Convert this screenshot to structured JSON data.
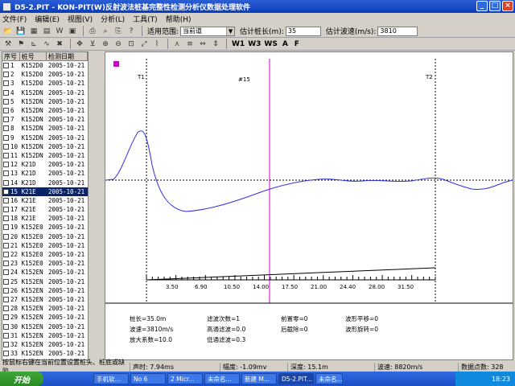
{
  "window": {
    "title": "D5-2.PIT - KON-PIT(W)反射波法桩基完整性检测分析仪数据处理软件"
  },
  "menu": [
    "文件(F)",
    "编辑(E)",
    "视图(V)",
    "分析(L)",
    "工具(T)",
    "帮助(H)"
  ],
  "toolbar": {
    "range_label": "适用范围:",
    "range_value": "当前道",
    "pile_len_label": "估计桩长(m):",
    "pile_len_value": "35",
    "wave_speed_label": "估计波速(m/s):",
    "wave_speed_value": "3810",
    "w1": "W1",
    "w3": "W3",
    "ws": "WS",
    "a": "A",
    "f": "F"
  },
  "list": {
    "headers": [
      "序号",
      "桩号",
      "检测日期"
    ],
    "rows": [
      [
        "1",
        "K152D0",
        "2005-10-21"
      ],
      [
        "2",
        "K152D0",
        "2005-10-21"
      ],
      [
        "3",
        "K152D0",
        "2005-10-21"
      ],
      [
        "4",
        "K152DN",
        "2005-10-21"
      ],
      [
        "5",
        "K152DN",
        "2005-10-21"
      ],
      [
        "6",
        "K152DN",
        "2005-10-21"
      ],
      [
        "7",
        "K152DN",
        "2005-10-21"
      ],
      [
        "8",
        "K152DN",
        "2005-10-21"
      ],
      [
        "9",
        "K152DN",
        "2005-10-21"
      ],
      [
        "10",
        "K152DN",
        "2005-10-21"
      ],
      [
        "11",
        "K152DN",
        "2005-10-21"
      ],
      [
        "12",
        "K21D",
        "2005-10-21"
      ],
      [
        "13",
        "K21D",
        "2005-10-21"
      ],
      [
        "14",
        "K21D",
        "2005-10-21"
      ],
      [
        "15",
        "K21E",
        "2005-10-21"
      ],
      [
        "16",
        "K21E",
        "2005-10-21"
      ],
      [
        "17",
        "K21E",
        "2005-10-21"
      ],
      [
        "18",
        "K21E",
        "2005-10-21"
      ],
      [
        "19",
        "K152E0",
        "2005-10-21"
      ],
      [
        "20",
        "K152E0",
        "2005-10-21"
      ],
      [
        "21",
        "K152E0",
        "2005-10-21"
      ],
      [
        "22",
        "K152E0",
        "2005-10-21"
      ],
      [
        "23",
        "K152E0",
        "2005-10-21"
      ],
      [
        "24",
        "K152EN",
        "2005-10-21"
      ],
      [
        "25",
        "K152EN",
        "2005-10-21"
      ],
      [
        "26",
        "K152EN",
        "2005-10-21"
      ],
      [
        "27",
        "K152EN",
        "2005-10-21"
      ],
      [
        "28",
        "K152EN",
        "2005-10-21"
      ],
      [
        "29",
        "K152EN",
        "2005-10-21"
      ],
      [
        "30",
        "K152EN",
        "2005-10-21"
      ],
      [
        "31",
        "K152EN",
        "2005-10-21"
      ],
      [
        "32",
        "K152EN",
        "2005-10-21"
      ],
      [
        "33",
        "K152EN",
        "2005-10-21"
      ]
    ],
    "selected_index": 14
  },
  "wave": {
    "marker_t1": "T1",
    "marker_t2": "T2",
    "trace_label": "#15",
    "scale_ticks": [
      "3.50",
      "6.90",
      "10.50",
      "14.00",
      "17.50",
      "21.00",
      "24.40",
      "28.00",
      "31.50"
    ],
    "marker_color": "#d000d0",
    "trace_color": "#3030e0"
  },
  "params": {
    "length": "桩长=35.0m",
    "speed": "波速=3810m/s",
    "gain": "放大系数=10.0",
    "filter_count": "滤波次数=1",
    "highpass": "高通滤波=0.0",
    "lowpass": "低通滤波=0.3",
    "pre_zero": "前置零=0",
    "post_cut": "后截除=0",
    "shift": "波形平移=0",
    "rotate": "波形旋转=0"
  },
  "status": {
    "hint": "按鼠标右键在当前位置设置桩头、桩底或缺陷",
    "time": "声时: 7.94ms",
    "amp": "幅度: -1.09mv",
    "depth": "深度: 15.1m",
    "speed": "波速: 8820m/s",
    "points": "数据点数: 328"
  },
  "taskbar": {
    "start": "开始",
    "tasks": [
      "手机软...",
      "No 6",
      "2 Micr...",
      "未命名...",
      "新建 M...",
      "D5-2.PIT...",
      "未命名..."
    ],
    "clock": "18:23"
  }
}
